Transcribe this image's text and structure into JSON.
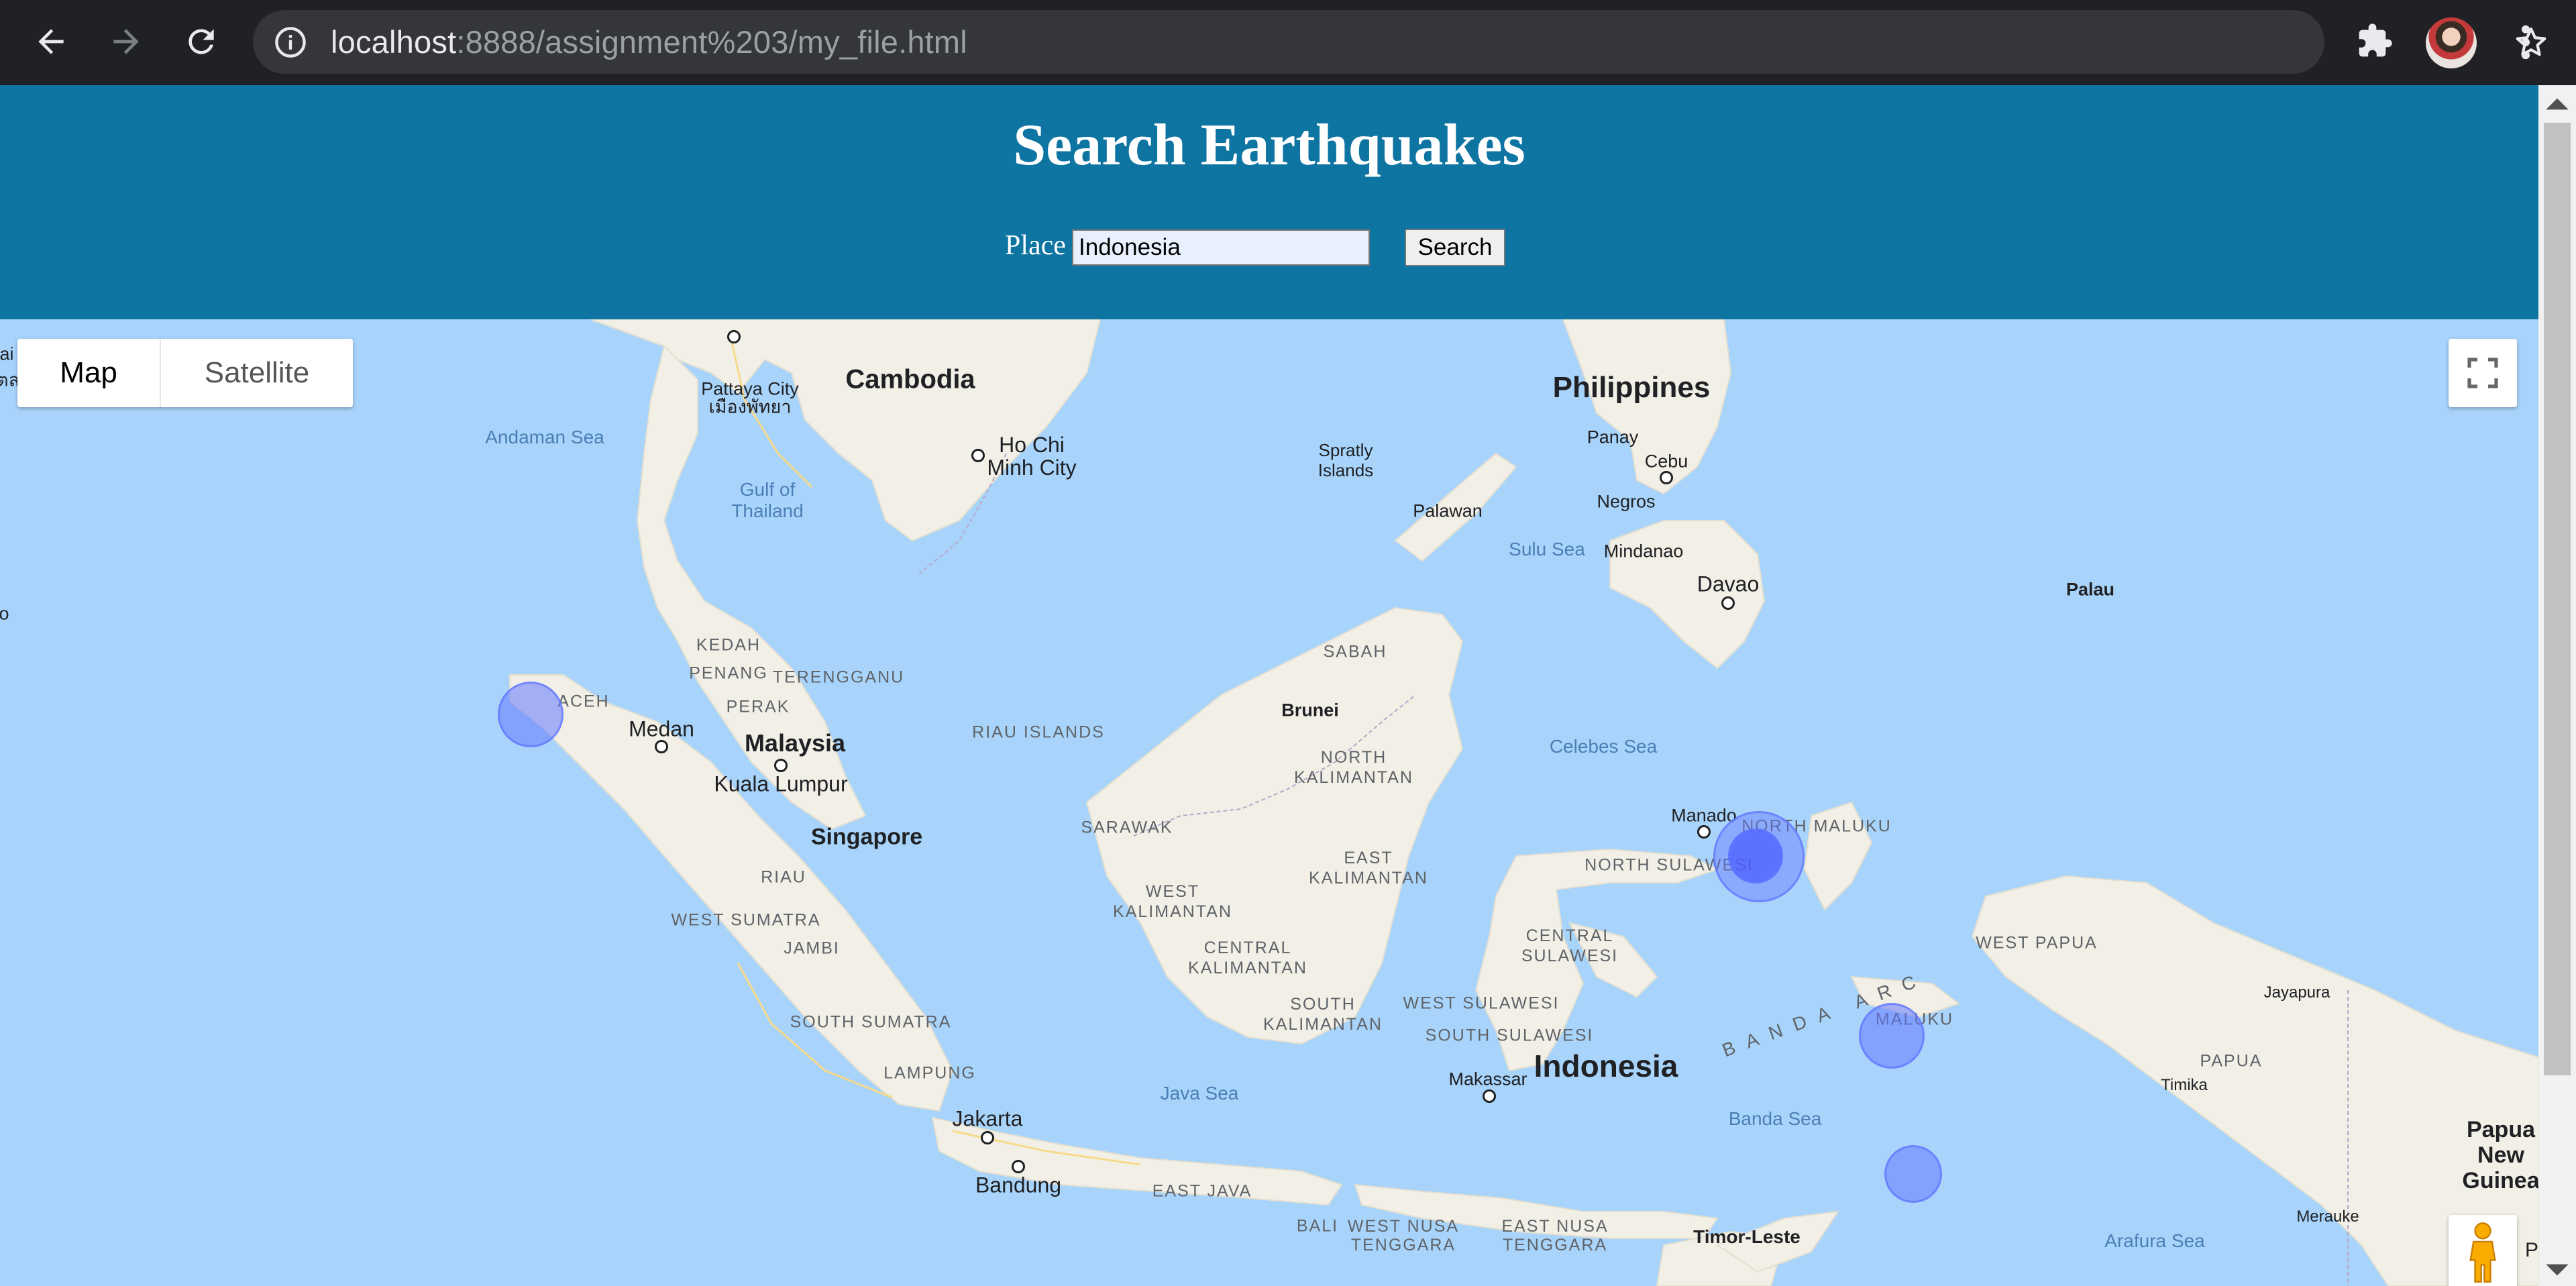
{
  "browser": {
    "url_host": "localhost",
    "url_path": ":8888/assignment%203/my_file.html"
  },
  "header": {
    "title": "Search Earthquakes",
    "place_label": "Place",
    "place_value": "Indonesia",
    "search_label": "Search"
  },
  "map": {
    "type_options": [
      "Map",
      "Satellite"
    ],
    "selected_type": "Map",
    "labels": {
      "countries": [
        "Cambodia",
        "Philippines",
        "Malaysia",
        "Indonesia",
        "Singapore",
        "Brunei",
        "Timor-Leste",
        "Papua New Guinea",
        "Palau"
      ],
      "cities": [
        "Pattaya City",
        "เมืองพัทยา",
        "Ho Chi Minh City",
        "Medan",
        "Kuala Lumpur",
        "Jakarta",
        "Bandung",
        "Davao",
        "Makassar",
        "Manado",
        "Jayapura",
        "Timika",
        "Merauke",
        "Cebu"
      ],
      "regions": [
        "ACEH",
        "KEDAH",
        "PENANG",
        "TERENGGANU",
        "PERAK",
        "RIAU ISLANDS",
        "RIAU",
        "WEST SUMATRA",
        "JAMBI",
        "SOUTH SUMATRA",
        "LAMPUNG",
        "SABAH",
        "NORTH KALIMANTAN",
        "SARAWAK",
        "EAST KALIMANTAN",
        "WEST KALIMANTAN",
        "CENTRAL KALIMANTAN",
        "SOUTH KALIMANTAN",
        "NORTH SULAWESI",
        "NORTH MALUKU",
        "CENTRAL SULAWESI",
        "WEST SULAWESI",
        "SOUTH SULAWESI",
        "MALUKU",
        "WEST PAPUA",
        "PAPUA",
        "EAST JAVA",
        "BALI",
        "WEST NUSA TENGGARA",
        "EAST NUSA TENGGARA",
        "BANDA ARC"
      ],
      "islands": [
        "Spratly Islands",
        "Palawan",
        "Panay",
        "Negros",
        "Mindanao"
      ],
      "seas": [
        "Andaman Sea",
        "Gulf of Thailand",
        "Sulu Sea",
        "Celebes Sea",
        "Java Sea",
        "Banda Sea",
        "Arafura Sea"
      ],
      "edge": [
        "ai",
        "ตล",
        "o",
        "P"
      ]
    },
    "earthquakes": [
      {
        "lat": 4.4,
        "lng": 95.6
      },
      {
        "lat": 1.6,
        "lng": 126.2
      },
      {
        "lat": 1.6,
        "lng": 126.2
      },
      {
        "lat": -3.9,
        "lng": 129.1
      },
      {
        "lat": -7.2,
        "lng": 129.5
      }
    ]
  },
  "icons": {
    "back": "arrow-left-icon",
    "forward": "arrow-right-icon",
    "reload": "reload-icon",
    "info": "info-icon",
    "zoom": "zoom-out-icon",
    "bookmark": "star-icon",
    "extensions": "puzzle-icon",
    "menu": "kebab-menu-icon",
    "fullscreen": "fullscreen-icon",
    "pegman": "pegman-icon"
  },
  "colors": {
    "header_bg": "#0e74a2",
    "water": "#a8d4fb",
    "land": "#f1efe6",
    "quake": "#6378ff"
  }
}
